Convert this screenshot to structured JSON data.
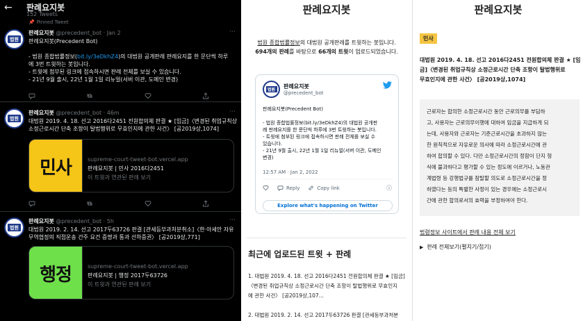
{
  "twitter": {
    "back_glyph": "←",
    "title": "판례요지봇",
    "tweet_count": "152 Tweets",
    "pinned_label": "Pinned Tweet",
    "avatar_text": "법원",
    "tweets": [
      {
        "name": "판례요지봇",
        "handle": "@precedent_bot",
        "time": "· Jan 2",
        "lines": [
          "판례요지봇(Precedent Bot)",
          "",
          "- 법원 종합법률정보(",
          "bit.ly/3eDkhZ4",
          ")의 대법원 공개판례 판례요지를 한 문단씩 하루",
          "에 3번 트윗하는 봇입니다.",
          "- 트윗에 첨부된 링크에 접속하시면 판례 전체를 보실 수 있습니다.",
          "- 21년 9월 출시, 22년 1월 1일 리뉴얼(서버 이관, 도메인 변경)"
        ]
      },
      {
        "name": "판례요지봇",
        "handle": "@precedent_bot",
        "time": "· 46m",
        "lines": [
          "대법원 2019. 4. 18. 선고 2016다2451 전원합의체 판결 ★ [임금]〈변경된 취업규칙상",
          "소정근로시간 단축 조항이 탈법행위로 무효인지에 관한 사건〉 [공2019상,1074]"
        ],
        "card": {
          "image_label": "민사",
          "image_color": "#f5c518",
          "url": "supreme-court-tweet-bot.vercel.app",
          "title": "판례요지봇 | 민사 2016다2451",
          "desc": "이 트윗과 연관된 판례 보기"
        }
      },
      {
        "name": "판례요지봇",
        "handle": "@precedent_bot",
        "time": "· 5h",
        "lines": [
          "대법원 2019. 2. 14. 선고 2017두63726 판결 [관세등부과처분취소]〈한·아세안 자유",
          "무역협정의 직접운송 간주 요건 증명과 통과 선하증권〉 [공2019상,771]"
        ],
        "card": {
          "image_label": "행정",
          "image_color": "#6ee04a",
          "url": "supreme-court-tweet-bot.vercel.app",
          "title": "판례요지봇 | 행정 2017두63726",
          "desc": "이 트윗과 연관된 판례 보기"
        }
      }
    ]
  },
  "middle": {
    "title": "판례요지봇",
    "intro_link": "법원 종합법률정보",
    "intro_rest": "의 대법원 공개판례를 트윗하는 봇입니다.",
    "intro_count_a": "694개의 판례",
    "intro_mid": "를 바탕으로 ",
    "intro_count_b": "66개의 트윗",
    "intro_end": "이 업로드되었습니다.",
    "embed": {
      "name": "판례요지봇",
      "handle": "@precedent_bot",
      "avatar_text": "법원",
      "body": [
        "판례요지봇(Precedent Bot)",
        "",
        "- 법원 종합법률정보(bit.ly/3eDkhZ4)의 대법원 공개판",
        "례 판례요지를 한 문단씩 하루에 3번 트윗하는 봇입니다.",
        "- 트윗에 첨부된 링크에 접속하시면 판례 전체를 보실 수",
        "있습니다.",
        "- 21년 9월 출시, 22년 1월 1일 리뉴얼(서버 이관, 도메인",
        "변경)"
      ],
      "time": "12:57 AM · Jan 2, 2022",
      "reply": "Reply",
      "copy": "Copy link",
      "cta": "Explore what's happening on Twitter"
    },
    "recent_heading": "최근에 업로드된 트윗 + 판례",
    "recent_list": [
      "1. 대법원 2019. 4. 18. 선고 2016다2451 전원합의체 판결 ★ [임금]",
      "〈변경된 취업규칙상 소정근로시간 단축 조항이 탈법행위로 무효인지",
      "에 관한 사건〉 [공2019상,107...",
      "",
      "2. 대법원 2019. 2. 14. 선고 2017두63726 판결 [관세등부과처분"
    ]
  },
  "right": {
    "title": "판례요지봇",
    "badge": "민사",
    "case_lines": [
      "대법원 2019. 4. 18. 선고 2016다2451 전원합의체 판결 ★ [임",
      "금]〈변경된 취업규칙상 소정근로시간 단축 조항이 탈법행위로",
      "무효인지에 관한 사건〉 [공2019상,1074]"
    ],
    "summary_lines": [
      "근로자는 합의한 소정근로시간 동안 근로의무를 부담하",
      "고, 사용자는 근로의무이행에 대하여 임금을 지급하게 되",
      "는데, 사용자와 근로자는 기준근로시간을 초과하지 않는",
      "한 원칙적으로 자유로운 의사에 따라 소정근로시간에 관",
      "하여 합의할 수 있다. 다만 소정근로시간의 정함이 단지 형",
      "식에 불과하다고 평가할 수 있는 정도에 이르거나, 노동관",
      "계법령 등 강행법규를 잠탈할 의도로 소정근로시간을 정",
      "하였다는 등의 특별한 사정이 있는 경우에는 소정근로시",
      "간에 관한 합의로서의 효력을 부정하여야 한다."
    ],
    "full_link": "법령정보 사이트에서 판례 내용 전체 보기",
    "toggle": "판례 전체보기(펼치기/접기)"
  },
  "colors": {
    "twitter_bg": "#000000",
    "twitter_link": "#1d9bf0",
    "badge_yellow": "#f5c542",
    "card_civil": "#f5c518",
    "card_admin": "#6ee04a"
  }
}
